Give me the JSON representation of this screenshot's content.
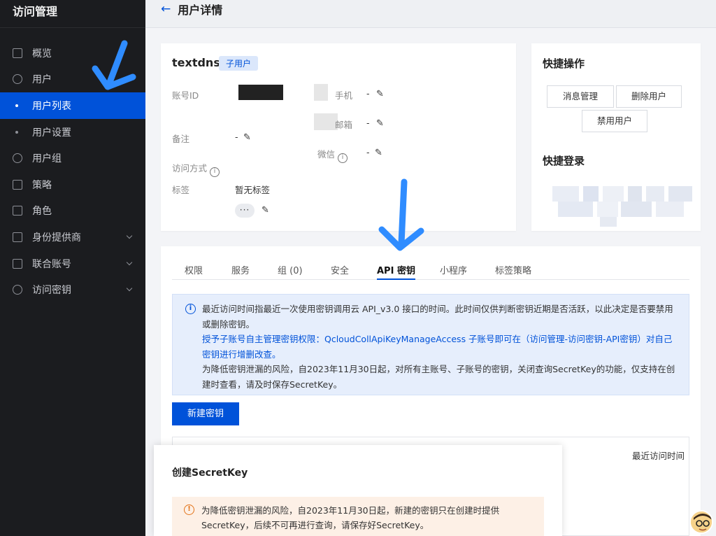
{
  "sidebar": {
    "title": "访问管理",
    "items": [
      {
        "label": "概览",
        "icon": "grid-icon"
      },
      {
        "label": "用户",
        "icon": "user-icon"
      },
      {
        "label": "用户列表",
        "icon": "dot"
      },
      {
        "label": "用户设置",
        "icon": "dot"
      },
      {
        "label": "用户组",
        "icon": "users-icon"
      },
      {
        "label": "策略",
        "icon": "policy-icon"
      },
      {
        "label": "角色",
        "icon": "role-icon"
      },
      {
        "label": "身份提供商",
        "icon": "idp-icon"
      },
      {
        "label": "联合账号",
        "icon": "federated-icon"
      },
      {
        "label": "访问密钥",
        "icon": "key-icon"
      }
    ]
  },
  "header": {
    "back_icon": "←",
    "title": "用户详情"
  },
  "user": {
    "name": "textdns",
    "badge": "子用户",
    "account_id_label": "账号ID",
    "remark_label": "备注",
    "remark_value": "-",
    "access_label": "访问方式",
    "tags_label": "标签",
    "tags_value": "暂无标签",
    "more": "···",
    "phone_label": "手机",
    "phone_value": "-",
    "email_label": "邮箱",
    "email_value": "-",
    "wechat_label": "微信",
    "wechat_value": "-"
  },
  "quick": {
    "title": "快捷操作",
    "buttons": [
      "消息管理",
      "删除用户",
      "禁用用户"
    ],
    "login_title": "快捷登录"
  },
  "tabs": [
    "权限",
    "服务",
    "组 (0)",
    "安全",
    "API 密钥",
    "小程序",
    "标签策略"
  ],
  "active_tab": "API 密钥",
  "notice": {
    "line1": "最近访问时间指最近一次使用密钥调用云 API_v3.0 接口的时间。此时间仅供判断密钥近期是否活跃，以此决定是否要禁用或删除密钥。",
    "link": "授予子账号自主管理密钥权限：QcloudCollApiKeyManageAccess 子账号即可在（访问管理-访问密钥-API密钥）对自己密钥进行增删改查。",
    "line3": "为降低密钥泄漏的风险，自2023年11月30日起，对所有主账号、子账号的密钥，关闭查询SecretKey的功能，仅支持在创建时查看，请及时保存SecretKey。"
  },
  "new_key_button": "新建密钥",
  "table": {
    "last_col": "最近访问时间"
  },
  "modal": {
    "title": "创建SecretKey",
    "warning": "为降低密钥泄漏的风险，自2023年11月30日起，新建的密钥只在创建时提供SecretKey，后续不可再进行查询，请保存好SecretKey。"
  },
  "colors": {
    "accent": "#0052d9",
    "sidebar_bg": "#1b1c1f",
    "warn": "#e37318",
    "annotation": "#2f8cff"
  }
}
